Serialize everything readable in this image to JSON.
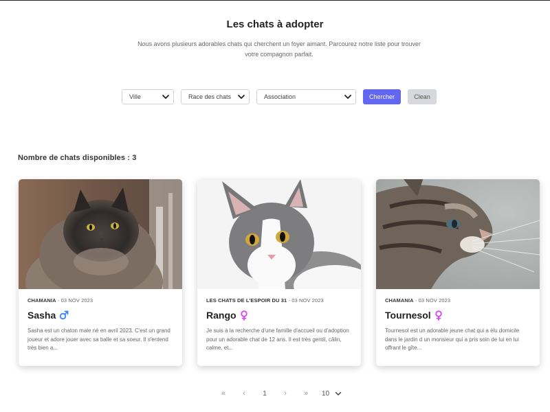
{
  "header": {
    "title": "Les chats à adopter",
    "subtitle": "Nous avons plusieurs adorables chats qui cherchent un foyer aimant. Parcourez notre liste pour trouver votre compagnon parfait."
  },
  "filters": {
    "city_label": "Ville",
    "breed_label": "Race des chats",
    "association_label": "Association",
    "search_label": "Chercher",
    "clean_label": "Clean"
  },
  "count_text": "Nombre de chats disponibles : 3",
  "cards": [
    {
      "association": "CHAMANIA",
      "date": "03 NOV 2023",
      "name": "Sasha",
      "sex": "male",
      "description": "Sasha est un chaton male né en avril 2023. C'est un grand joueur et adore jouer avec sa balle et sa soeur. Il s'entend très bien a..."
    },
    {
      "association": "LES CHATS DE L'ESPOIR DU 31",
      "date": "03 NOV 2023",
      "name": "Rango",
      "sex": "female",
      "description": "Je suis à la recherche d'une famille d'accueil ou d'adoption pour un adorable chat de 12 ans. Il est très gentil, câlin, calme, et..."
    },
    {
      "association": "CHAMANIA",
      "date": "03 NOV 2023",
      "name": "Tournesol",
      "sex": "female",
      "description": "Tournesol est un adorable jeune chat qui a élu domicile dans le jardin d un monsieur qui a pris soin de lui en lui offrant le gîte..."
    }
  ],
  "pagination": {
    "first": "«",
    "prev": "‹",
    "current_page": "1",
    "next": "›",
    "last": "»",
    "per_page": "10"
  },
  "colors": {
    "accent": "#6366f1",
    "male": "#3b82f6",
    "female": "#d946ef"
  }
}
